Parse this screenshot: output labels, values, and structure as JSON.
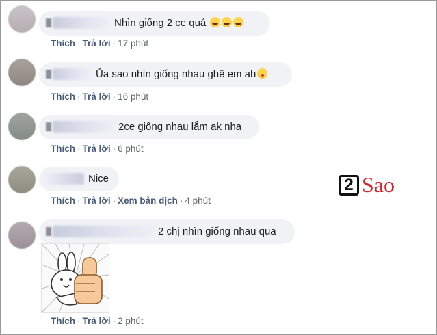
{
  "comments": [
    {
      "text": "Nhìn giống 2 ce quá",
      "emojis": [
        "rolling-on-floor-laughing",
        "rolling-on-floor-laughing",
        "rolling-on-floor-laughing"
      ],
      "like": "Thích",
      "reply": "Trả lời",
      "time": "17 phút"
    },
    {
      "text": "Ủa sao nhìn giống nhau ghê em ah",
      "emojis": [
        "face-blowing-kiss"
      ],
      "like": "Thích",
      "reply": "Trả lời",
      "time": "16 phút"
    },
    {
      "text": "2ce giống nhau lắm ak nha",
      "emojis": [],
      "like": "Thích",
      "reply": "Trả lời",
      "time": "6 phút"
    },
    {
      "text": "Nice",
      "emojis": [],
      "like": "Thích",
      "reply": "Trả lời",
      "translate": "Xem bản dịch",
      "time": "4 phút"
    },
    {
      "text": "2 chị nhìn giống nhau qua",
      "emojis": [],
      "sticker": "rabbit-thumbs-up-sticker",
      "like": "Thích",
      "reply": "Trả lời",
      "time": "2 phút"
    }
  ],
  "watermark": {
    "digit": "2",
    "word": "Sao",
    "accent": "#d2232a"
  },
  "colors": {
    "bubble": "#f0f2f5",
    "text": "#1c1e21",
    "meta": "#606770",
    "link": "#4a5b7a"
  }
}
